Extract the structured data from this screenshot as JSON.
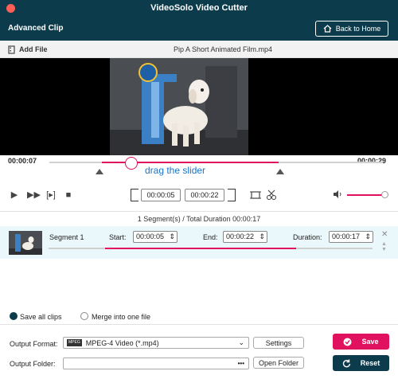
{
  "window": {
    "title": "VideoSolo Video Cutter"
  },
  "header": {
    "title": "Advanced Clip",
    "back_label": "Back to Home"
  },
  "filebar": {
    "add_label": "Add File",
    "filename": "Pip  A Short Animated Film.mp4"
  },
  "timeline": {
    "current": "00:00:07",
    "total": "00:00:29",
    "hint": "drag the slider"
  },
  "controls": {
    "start_time": "00:00:05",
    "end_time": "00:00:22"
  },
  "summary": "1 Segment(s) / Total Duration 00:00:17",
  "segment": {
    "name": "Segment 1",
    "start_label": "Start:",
    "start": "00:00:05",
    "end_label": "End:",
    "end": "00:00:22",
    "duration_label": "Duration:",
    "duration": "00:00:17"
  },
  "options": {
    "save_all": "Save all clips",
    "merge": "Merge into one file",
    "selected": "save_all"
  },
  "output": {
    "format_label": "Output Format:",
    "format_value": "MPEG-4 Video (*.mp4)",
    "format_icon_text": "MPEG",
    "settings_label": "Settings",
    "folder_label": "Output Folder:",
    "folder_value": "",
    "browse_label": "•••",
    "open_folder_label": "Open Folder"
  },
  "actions": {
    "save": "Save",
    "reset": "Reset"
  },
  "colors": {
    "header": "#0c3c4c",
    "accent": "#e0115f",
    "hint": "#1a73c9",
    "segment_row": "#eaf7fb"
  }
}
